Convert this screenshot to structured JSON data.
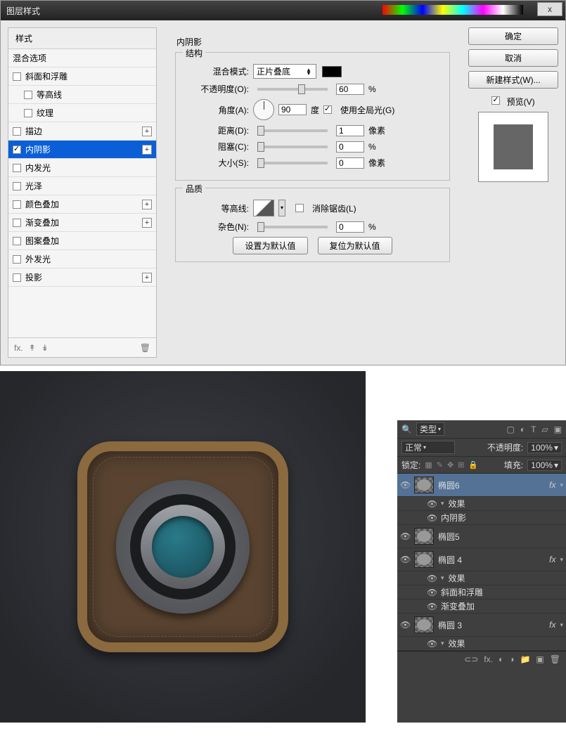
{
  "dialog": {
    "title": "图层样式",
    "close": "x"
  },
  "styles": {
    "header": "样式",
    "blendopts": "混合选项",
    "items": [
      {
        "label": "斜面和浮雕",
        "checked": false,
        "indent": false,
        "plus": false
      },
      {
        "label": "等高线",
        "checked": false,
        "indent": true,
        "plus": false
      },
      {
        "label": "纹理",
        "checked": false,
        "indent": true,
        "plus": false
      },
      {
        "label": "描边",
        "checked": false,
        "indent": false,
        "plus": true
      },
      {
        "label": "内阴影",
        "checked": true,
        "indent": false,
        "plus": true,
        "selected": true
      },
      {
        "label": "内发光",
        "checked": false,
        "indent": false,
        "plus": false
      },
      {
        "label": "光泽",
        "checked": false,
        "indent": false,
        "plus": false
      },
      {
        "label": "颜色叠加",
        "checked": false,
        "indent": false,
        "plus": true
      },
      {
        "label": "渐变叠加",
        "checked": false,
        "indent": false,
        "plus": true
      },
      {
        "label": "图案叠加",
        "checked": false,
        "indent": false,
        "plus": false
      },
      {
        "label": "外发光",
        "checked": false,
        "indent": false,
        "plus": false
      },
      {
        "label": "投影",
        "checked": false,
        "indent": false,
        "plus": true
      }
    ],
    "foot_fx": "fx.",
    "foot_up": "↟",
    "foot_down": "↡",
    "foot_trash": "🗑"
  },
  "params": {
    "section_title": "内阴影",
    "group_structure": "结构",
    "blendmode_lbl": "混合模式:",
    "blendmode_val": "正片叠底",
    "opacity_lbl": "不透明度(O):",
    "opacity_val": "60",
    "opacity_unit": "%",
    "angle_lbl": "角度(A):",
    "angle_val": "90",
    "angle_unit": "度",
    "global_light": "使用全局光(G)",
    "distance_lbl": "距离(D):",
    "distance_val": "1",
    "distance_unit": "像素",
    "choke_lbl": "阻塞(C):",
    "choke_val": "0",
    "choke_unit": "%",
    "size_lbl": "大小(S):",
    "size_val": "0",
    "size_unit": "像素",
    "group_quality": "品质",
    "contour_lbl": "等高线:",
    "antialias": "消除锯齿(L)",
    "noise_lbl": "杂色(N):",
    "noise_val": "0",
    "noise_unit": "%",
    "btn_default": "设置为默认值",
    "btn_reset": "复位为默认值"
  },
  "buttons": {
    "ok": "确定",
    "cancel": "取消",
    "newstyle": "新建样式(W)...",
    "preview": "预览(V)"
  },
  "layerspanel": {
    "kind_icon": "🔍",
    "kind": "类型",
    "mode": "正常",
    "opacity_lbl": "不透明度:",
    "opacity_val": "100%",
    "lock_lbl": "锁定:",
    "fill_lbl": "填充:",
    "fill_val": "100%",
    "layers": [
      {
        "name": "椭圆6",
        "fx": true,
        "selected": true,
        "subs": [
          "效果",
          "内阴影"
        ]
      },
      {
        "name": "椭圆5",
        "fx": false,
        "subs": []
      },
      {
        "name": "椭圆 4",
        "fx": true,
        "subs": [
          "效果",
          "斜面和浮雕",
          "渐变叠加"
        ]
      },
      {
        "name": "椭圆 3",
        "fx": true,
        "subs": [
          "效果"
        ]
      }
    ],
    "foot": {
      "link": "⊂⊃",
      "fx": "fx.",
      "mask": "◐",
      "adj": "◑",
      "folder": "📁",
      "new": "▣",
      "trash": "🗑"
    }
  }
}
